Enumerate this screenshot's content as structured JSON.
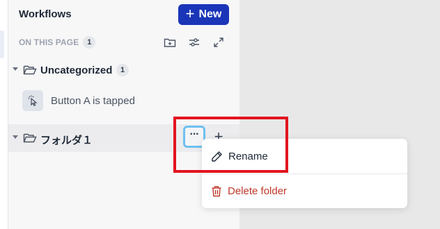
{
  "header": {
    "title": "Workflows",
    "new_label": "New"
  },
  "subheader": {
    "label": "ON THIS PAGE",
    "count": "1"
  },
  "folders": [
    {
      "name": "Uncategorized",
      "count": "1"
    },
    {
      "name": "フォルダ１"
    }
  ],
  "workflow_item": {
    "label": "Button A is tapped"
  },
  "context_menu": {
    "rename": "Rename",
    "delete": "Delete folder"
  },
  "colors": {
    "primary": "#1a35b8",
    "danger": "#c0392b",
    "highlight": "#e3141e",
    "focus": "#6ec0f0"
  }
}
